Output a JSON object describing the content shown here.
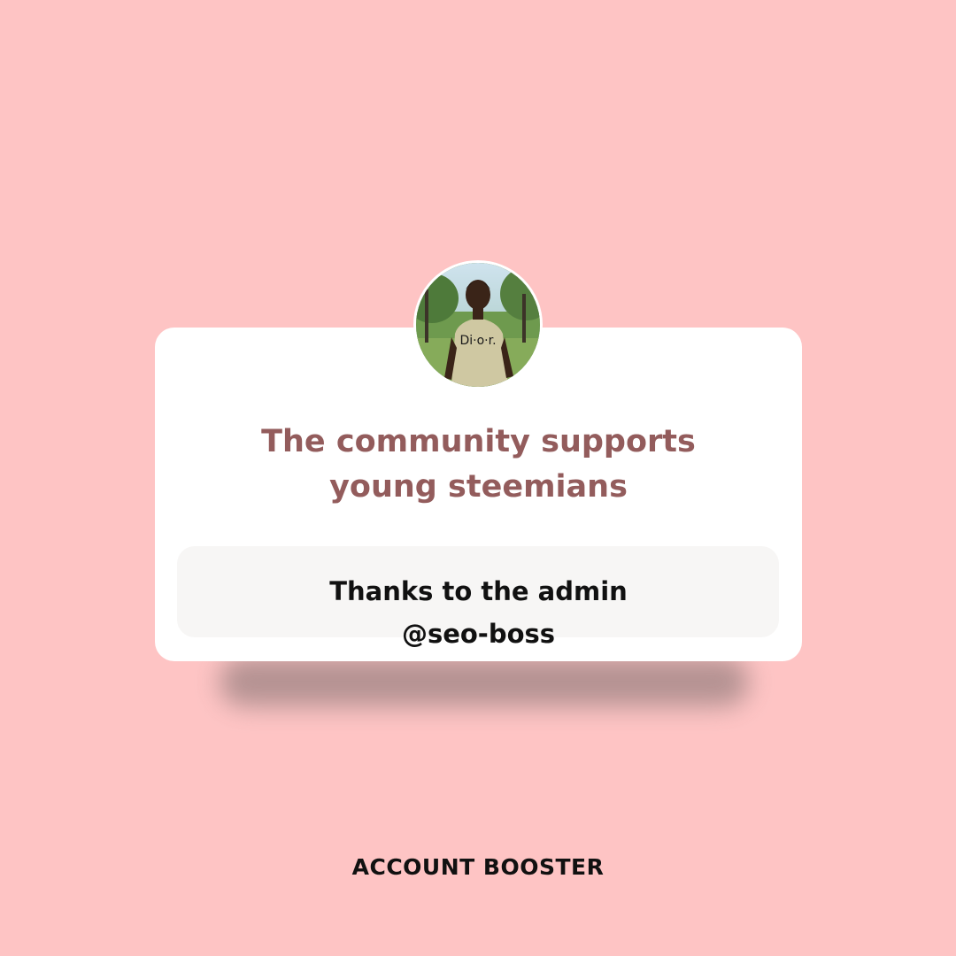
{
  "card": {
    "headline": "The community supports young steemians",
    "thanks_line1": "Thanks to the admin",
    "thanks_line2": "@seo-boss"
  },
  "avatar": {
    "shirt_text": "Di·o·r."
  },
  "footer": {
    "brand": "ACCOUNT BOOSTER"
  },
  "colors": {
    "background": "#fec4c4",
    "card": "#ffffff",
    "headline": "#935c5c",
    "inner_box": "#f7f6f5",
    "text_dark": "#111111"
  }
}
